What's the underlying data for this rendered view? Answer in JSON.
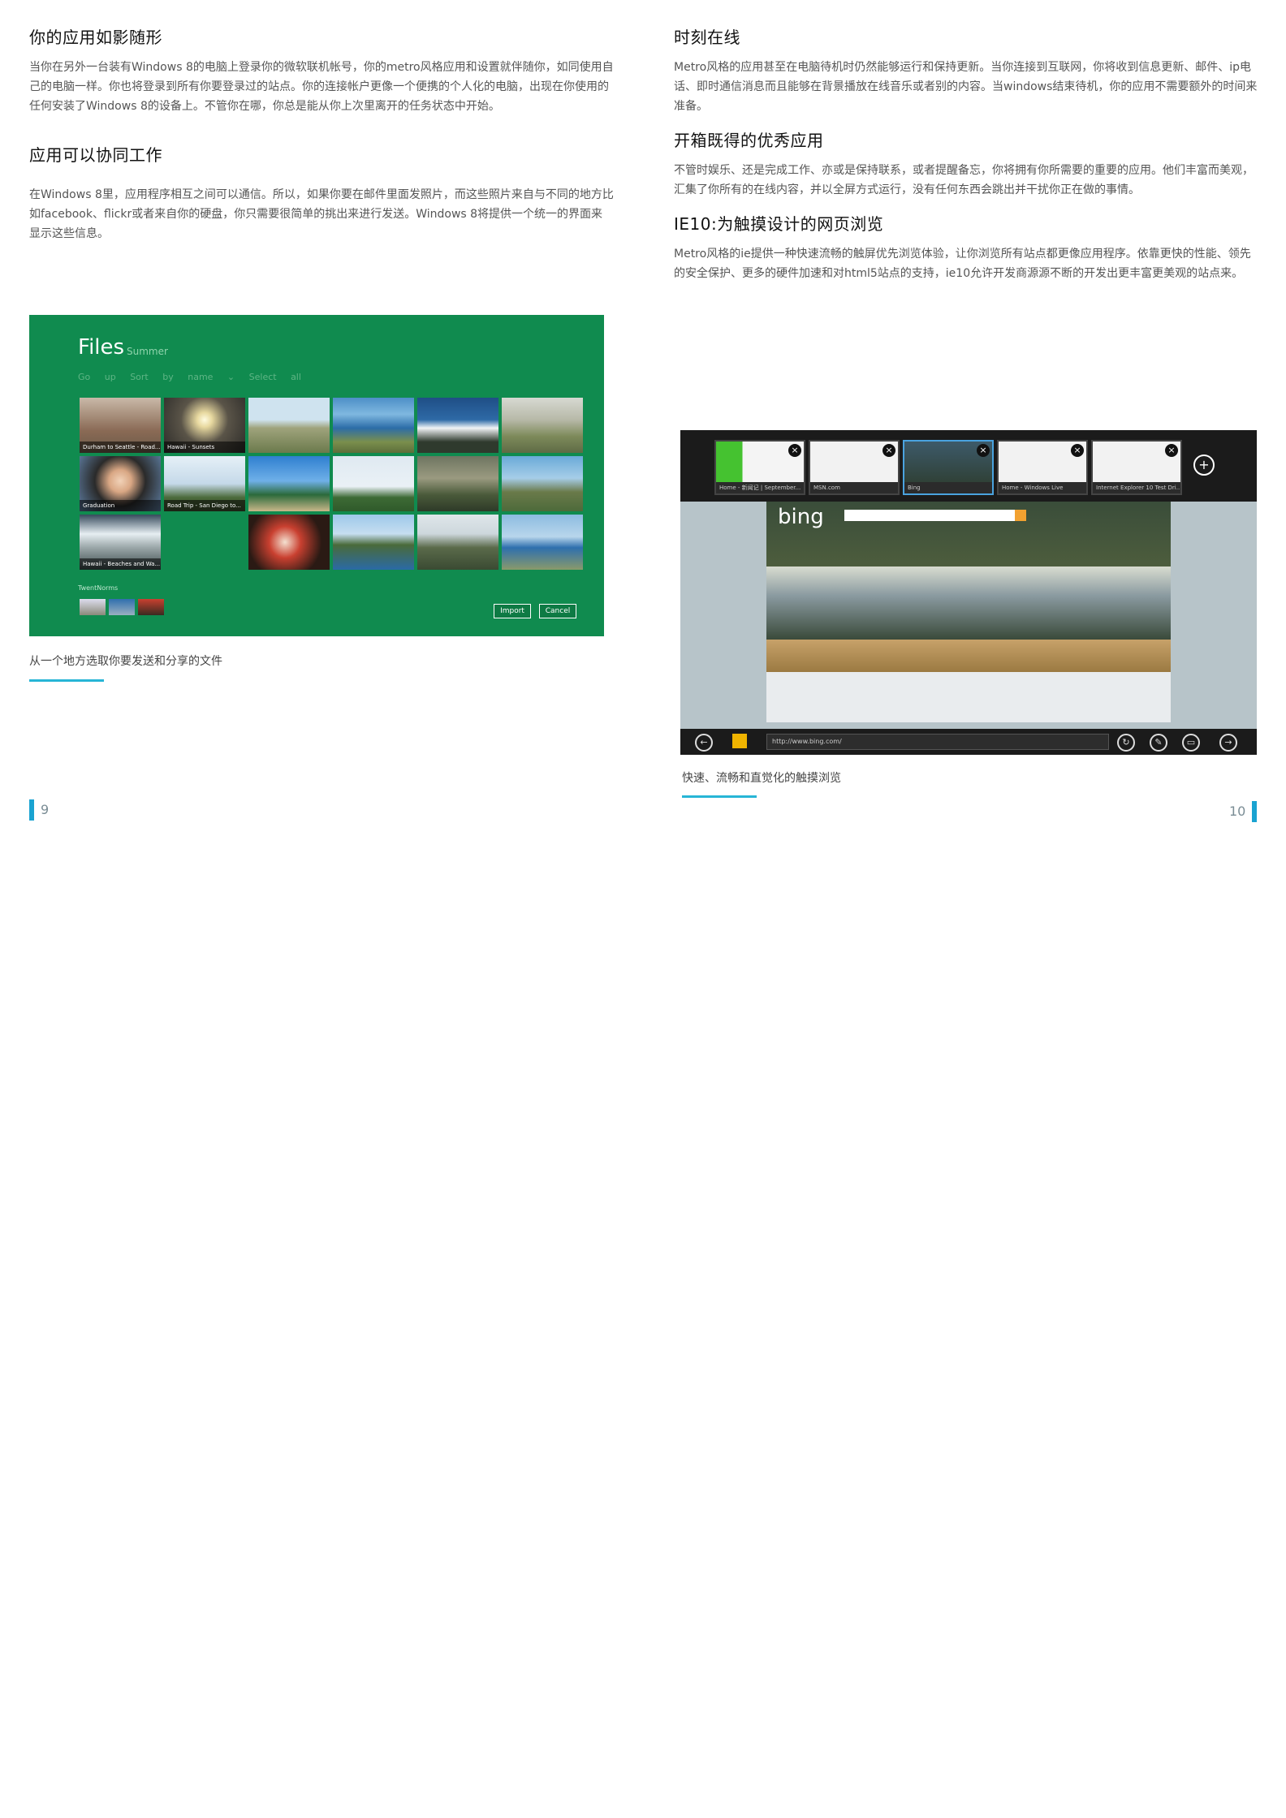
{
  "left": {
    "sections": [
      {
        "title": "你的应用如影随形",
        "body": "当你在另外一台装有Windows 8的电脑上登录你的微软联机帐号，你的metro风格应用和设置就伴随你，如同使用自己的电脑一样。你也将登录到所有你要登录过的站点。你的连接帐户更像一个便携的个人化的电脑，出现在你使用的任何安装了Windows 8的设备上。不管你在哪，你总是能从你上次里离开的任务状态中开始。"
      },
      {
        "title": "应用可以协同工作",
        "body": "在Windows 8里，应用程序相互之间可以通信。所以，如果你要在邮件里面发照片，而这些照片来自与不同的地方比如facebook、flickr或者来自你的硬盘，你只需要很简单的挑出来进行发送。Windows 8将提供一个统一的界面来显示这些信息。"
      }
    ],
    "caption": "从一个地方选取你要发送和分享的文件",
    "page_number": "9"
  },
  "right": {
    "sections": [
      {
        "title": "时刻在线",
        "body": "Metro风格的应用甚至在电脑待机时仍然能够运行和保持更新。当你连接到互联网，你将收到信息更新、邮件、ip电话、即时通信消息而且能够在背景播放在线音乐或者别的内容。当windows结束待机，你的应用不需要额外的时间来准备。"
      },
      {
        "title": "开箱既得的优秀应用",
        "body": "不管时娱乐、还是完成工作、亦或是保持联系，或者提醒备忘，你将拥有你所需要的重要的应用。他们丰富而美观，汇集了你所有的在线内容，并以全屏方式运行，没有任何东西会跳出并干扰你正在做的事情。"
      },
      {
        "title": "IE10:为触摸设计的网页浏览",
        "body": "Metro风格的ie提供一种快速流畅的触屏优先浏览体验，让你浏览所有站点都更像应用程序。依靠更快的性能、领先的安全保护、更多的硬件加速和对html5站点的支持，ie10允许开发商源源不断的开发出更丰富更美观的站点来。"
      }
    ],
    "caption": "快速、流畅和直觉化的触摸浏览",
    "page_number": "10"
  },
  "files_screen": {
    "title": "Files",
    "subtitle": "Summer",
    "toolbar": "Go up    Sort by name ⌄    Select all",
    "tile_captions": [
      "Durham to Seattle - Road...",
      "Hawaii - Sunsets",
      "Graduation",
      "Road Trip - San Diego to...",
      "Hawaii - Beaches and Wa..."
    ],
    "sky_label": "TwentNorms",
    "import_label": "Import",
    "cancel_label": "Cancel",
    "accent": "#108b4f"
  },
  "ie_screen": {
    "tab_labels": [
      "Home - 新闻记 | September...",
      "MSN.com",
      "Bing",
      "Home - Windows Live",
      "Internet Explorer 10 Test Dri..."
    ],
    "logo": "bing",
    "url": "http://www.bing.com/"
  },
  "colors": {
    "accent_line": "#27b5d6",
    "page_bar": "#1aa3d1"
  }
}
